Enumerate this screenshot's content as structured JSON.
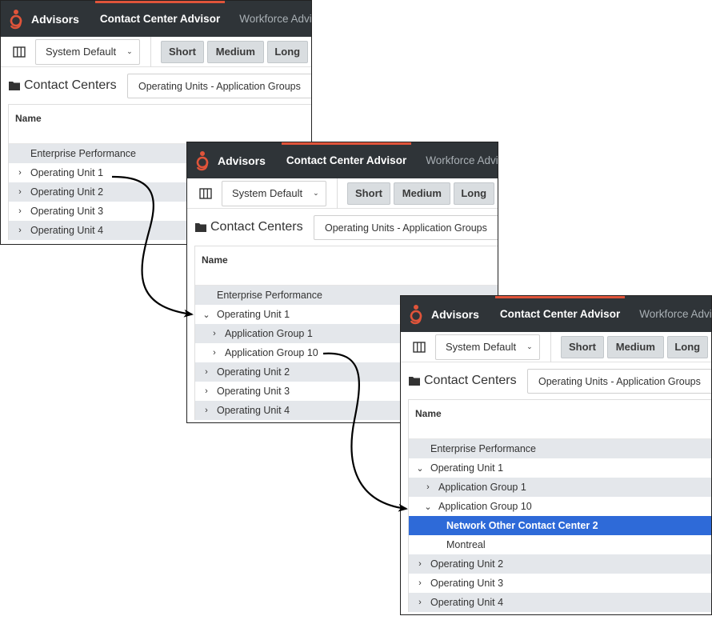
{
  "nav": {
    "brand": "Advisors",
    "tabs": [
      "Contact Center Advisor",
      "Workforce Advisor"
    ]
  },
  "toolbar": {
    "view_select": "System Default",
    "periods": [
      "Short",
      "Medium",
      "Long"
    ]
  },
  "section": {
    "title": "Contact Centers",
    "grouping": "Operating Units - Application Groups"
  },
  "grid": {
    "column": "Name"
  },
  "panels": [
    {
      "rows": [
        {
          "label": "Enterprise Performance",
          "level": 0,
          "caret": "none",
          "style": "shade"
        },
        {
          "label": "Operating Unit 1",
          "level": 0,
          "caret": "collapsed",
          "style": "plain"
        },
        {
          "label": "Operating Unit 2",
          "level": 0,
          "caret": "collapsed",
          "style": "shade"
        },
        {
          "label": "Operating Unit 3",
          "level": 0,
          "caret": "collapsed",
          "style": "plain"
        },
        {
          "label": "Operating Unit 4",
          "level": 0,
          "caret": "collapsed",
          "style": "shade"
        }
      ]
    },
    {
      "rows": [
        {
          "label": "Enterprise Performance",
          "level": 0,
          "caret": "none",
          "style": "shade"
        },
        {
          "label": "Operating Unit 1",
          "level": 0,
          "caret": "expanded",
          "style": "plain"
        },
        {
          "label": "Application Group 1",
          "level": 1,
          "caret": "collapsed",
          "style": "shade"
        },
        {
          "label": "Application Group 10",
          "level": 1,
          "caret": "collapsed",
          "style": "plain"
        },
        {
          "label": "Operating Unit 2",
          "level": 0,
          "caret": "collapsed",
          "style": "shade"
        },
        {
          "label": "Operating Unit 3",
          "level": 0,
          "caret": "collapsed",
          "style": "plain"
        },
        {
          "label": "Operating Unit 4",
          "level": 0,
          "caret": "collapsed",
          "style": "shade"
        }
      ]
    },
    {
      "rows": [
        {
          "label": "Enterprise Performance",
          "level": 0,
          "caret": "none",
          "style": "shade"
        },
        {
          "label": "Operating Unit 1",
          "level": 0,
          "caret": "expanded",
          "style": "plain"
        },
        {
          "label": "Application Group 1",
          "level": 1,
          "caret": "collapsed",
          "style": "shade"
        },
        {
          "label": "Application Group 10",
          "level": 1,
          "caret": "expanded",
          "style": "plain"
        },
        {
          "label": "Network Other Contact Center 2",
          "level": 2,
          "caret": "none",
          "style": "selected"
        },
        {
          "label": "Montreal",
          "level": 2,
          "caret": "none",
          "style": "plain"
        },
        {
          "label": "Operating Unit 2",
          "level": 0,
          "caret": "collapsed",
          "style": "shade"
        },
        {
          "label": "Operating Unit 3",
          "level": 0,
          "caret": "collapsed",
          "style": "plain"
        },
        {
          "label": "Operating Unit 4",
          "level": 0,
          "caret": "collapsed",
          "style": "shade"
        }
      ]
    }
  ],
  "colors": {
    "topbar": "#2f3438",
    "accent": "#e0543a",
    "selected_row": "#2e6ad8",
    "shaded_row": "#e4e7eb"
  }
}
